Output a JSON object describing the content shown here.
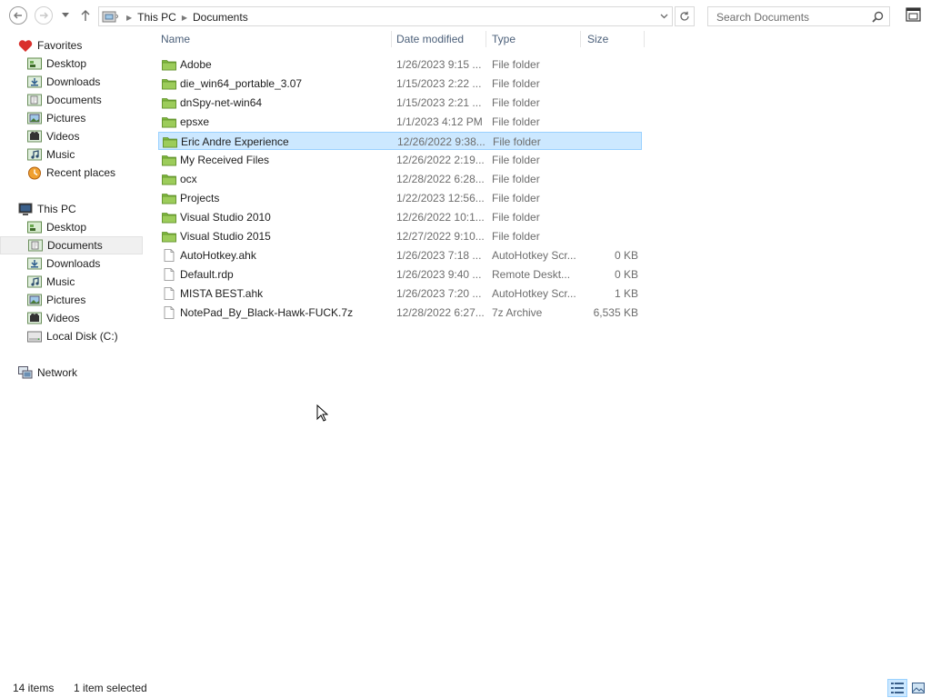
{
  "address": {
    "crumbs": [
      "This PC",
      "Documents"
    ]
  },
  "search": {
    "placeholder": "Search Documents"
  },
  "navpane": {
    "favorites": {
      "label": "Favorites",
      "items": [
        "Desktop",
        "Downloads",
        "Documents",
        "Pictures",
        "Videos",
        "Music",
        "Recent places"
      ]
    },
    "this_pc": {
      "label": "This PC",
      "items": [
        "Desktop",
        "Documents",
        "Downloads",
        "Music",
        "Pictures",
        "Videos",
        "Local Disk (C:)"
      ]
    },
    "network": {
      "label": "Network"
    }
  },
  "columns": {
    "name": "Name",
    "date": "Date modified",
    "type": "Type",
    "size": "Size"
  },
  "files": [
    {
      "name": "Adobe",
      "date": "1/26/2023 9:15 ...",
      "type": "File folder",
      "size": "",
      "kind": "folder"
    },
    {
      "name": "die_win64_portable_3.07",
      "date": "1/15/2023 2:22 ...",
      "type": "File folder",
      "size": "",
      "kind": "folder"
    },
    {
      "name": "dnSpy-net-win64",
      "date": "1/15/2023 2:21 ...",
      "type": "File folder",
      "size": "",
      "kind": "folder"
    },
    {
      "name": "epsxe",
      "date": "1/1/2023 4:12 PM",
      "type": "File folder",
      "size": "",
      "kind": "folder"
    },
    {
      "name": "Eric Andre Experience",
      "date": "12/26/2022 9:38...",
      "type": "File folder",
      "size": "",
      "kind": "folder",
      "selected": true
    },
    {
      "name": "My Received Files",
      "date": "12/26/2022 2:19...",
      "type": "File folder",
      "size": "",
      "kind": "folder"
    },
    {
      "name": "ocx",
      "date": "12/28/2022 6:28...",
      "type": "File folder",
      "size": "",
      "kind": "folder"
    },
    {
      "name": "Projects",
      "date": "1/22/2023 12:56...",
      "type": "File folder",
      "size": "",
      "kind": "folder"
    },
    {
      "name": "Visual Studio 2010",
      "date": "12/26/2022 10:1...",
      "type": "File folder",
      "size": "",
      "kind": "folder"
    },
    {
      "name": "Visual Studio 2015",
      "date": "12/27/2022 9:10...",
      "type": "File folder",
      "size": "",
      "kind": "folder"
    },
    {
      "name": "AutoHotkey.ahk",
      "date": "1/26/2023 7:18 ...",
      "type": "AutoHotkey Scr...",
      "size": "0 KB",
      "kind": "file"
    },
    {
      "name": "Default.rdp",
      "date": "1/26/2023 9:40 ...",
      "type": "Remote Deskt...",
      "size": "0 KB",
      "kind": "file"
    },
    {
      "name": "MISTA BEST.ahk",
      "date": "1/26/2023 7:20 ...",
      "type": "AutoHotkey Scr...",
      "size": "1 KB",
      "kind": "file"
    },
    {
      "name": "NotePad_By_Black-Hawk-FUCK.7z",
      "date": "12/28/2022 6:27...",
      "type": "7z Archive",
      "size": "6,535 KB",
      "kind": "file"
    }
  ],
  "status": {
    "count": "14 items",
    "selection": "1 item selected"
  },
  "colors": {
    "selection_bg": "#cce8ff",
    "selection_border": "#99d1ff",
    "folder": "#8cc63f",
    "header_text": "#4c607a"
  }
}
